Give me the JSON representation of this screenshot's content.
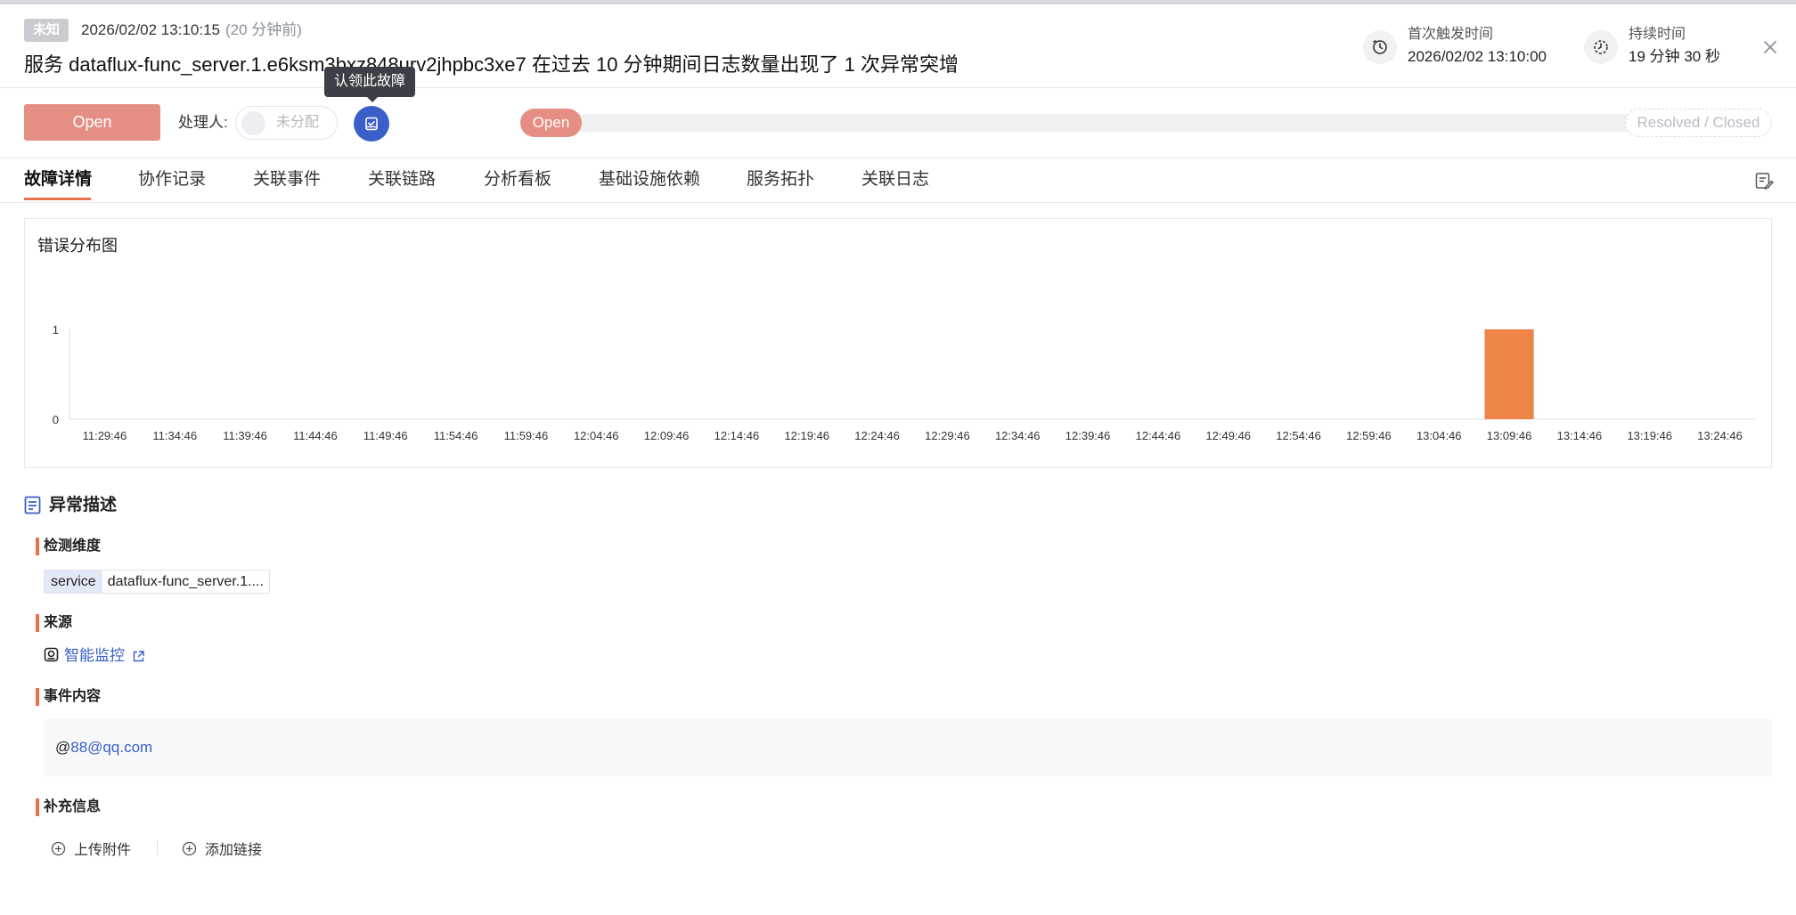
{
  "header": {
    "status_tag": "未知",
    "time": "2026/02/02 13:10:15",
    "ago": "(20 分钟前)",
    "title": "服务 dataflux-func_server.1.e6ksm3bxz848urv2jhpbc3xe7 在过去 10 分钟期间日志数量出现了 1 次异常突增",
    "first_trigger_label": "首次触发时间",
    "first_trigger_value": "2026/02/02 13:10:00",
    "duration_label": "持续时间",
    "duration_value": "19 分钟 30 秒"
  },
  "actions": {
    "open_label": "Open",
    "handler_label": "处理人:",
    "assignee_placeholder": "未分配",
    "claim_tooltip": "认领此故障",
    "progress_start": "Open",
    "progress_end": "Resolved / Closed"
  },
  "tabs": [
    {
      "label": "故障详情"
    },
    {
      "label": "协作记录"
    },
    {
      "label": "关联事件"
    },
    {
      "label": "关联链路"
    },
    {
      "label": "分析看板"
    },
    {
      "label": "基础设施依赖"
    },
    {
      "label": "服务拓扑"
    },
    {
      "label": "关联日志"
    }
  ],
  "chart_data": {
    "type": "bar",
    "title": "错误分布图",
    "categories": [
      "11:29:46",
      "11:34:46",
      "11:39:46",
      "11:44:46",
      "11:49:46",
      "11:54:46",
      "11:59:46",
      "12:04:46",
      "12:09:46",
      "12:14:46",
      "12:19:46",
      "12:24:46",
      "12:29:46",
      "12:34:46",
      "12:39:46",
      "12:44:46",
      "12:49:46",
      "12:54:46",
      "12:59:46",
      "13:04:46",
      "13:09:46",
      "13:14:46",
      "13:19:46",
      "13:24:46"
    ],
    "values": [
      0,
      0,
      0,
      0,
      0,
      0,
      0,
      0,
      0,
      0,
      0,
      0,
      0,
      0,
      0,
      0,
      0,
      0,
      0,
      0,
      1,
      0,
      0,
      0
    ],
    "ylim": [
      0,
      1
    ],
    "yticks": [
      "0",
      "1"
    ],
    "bar_color": "#ef8447",
    "grid": false
  },
  "description": {
    "section_title": "异常描述",
    "dimension_heading": "检测维度",
    "dimension_key": "service",
    "dimension_value": "dataflux-func_server.1....",
    "source_heading": "来源",
    "source_link": "智能监控",
    "content_heading": "事件内容",
    "content_prefix": "@",
    "content_mention": "88@qq.com",
    "extra_heading": "补充信息",
    "upload_label": "上传附件",
    "add_link_label": "添加链接"
  },
  "colors": {
    "accent": "#e8734a",
    "open": "#e58f84",
    "link": "#3b5fc9"
  }
}
